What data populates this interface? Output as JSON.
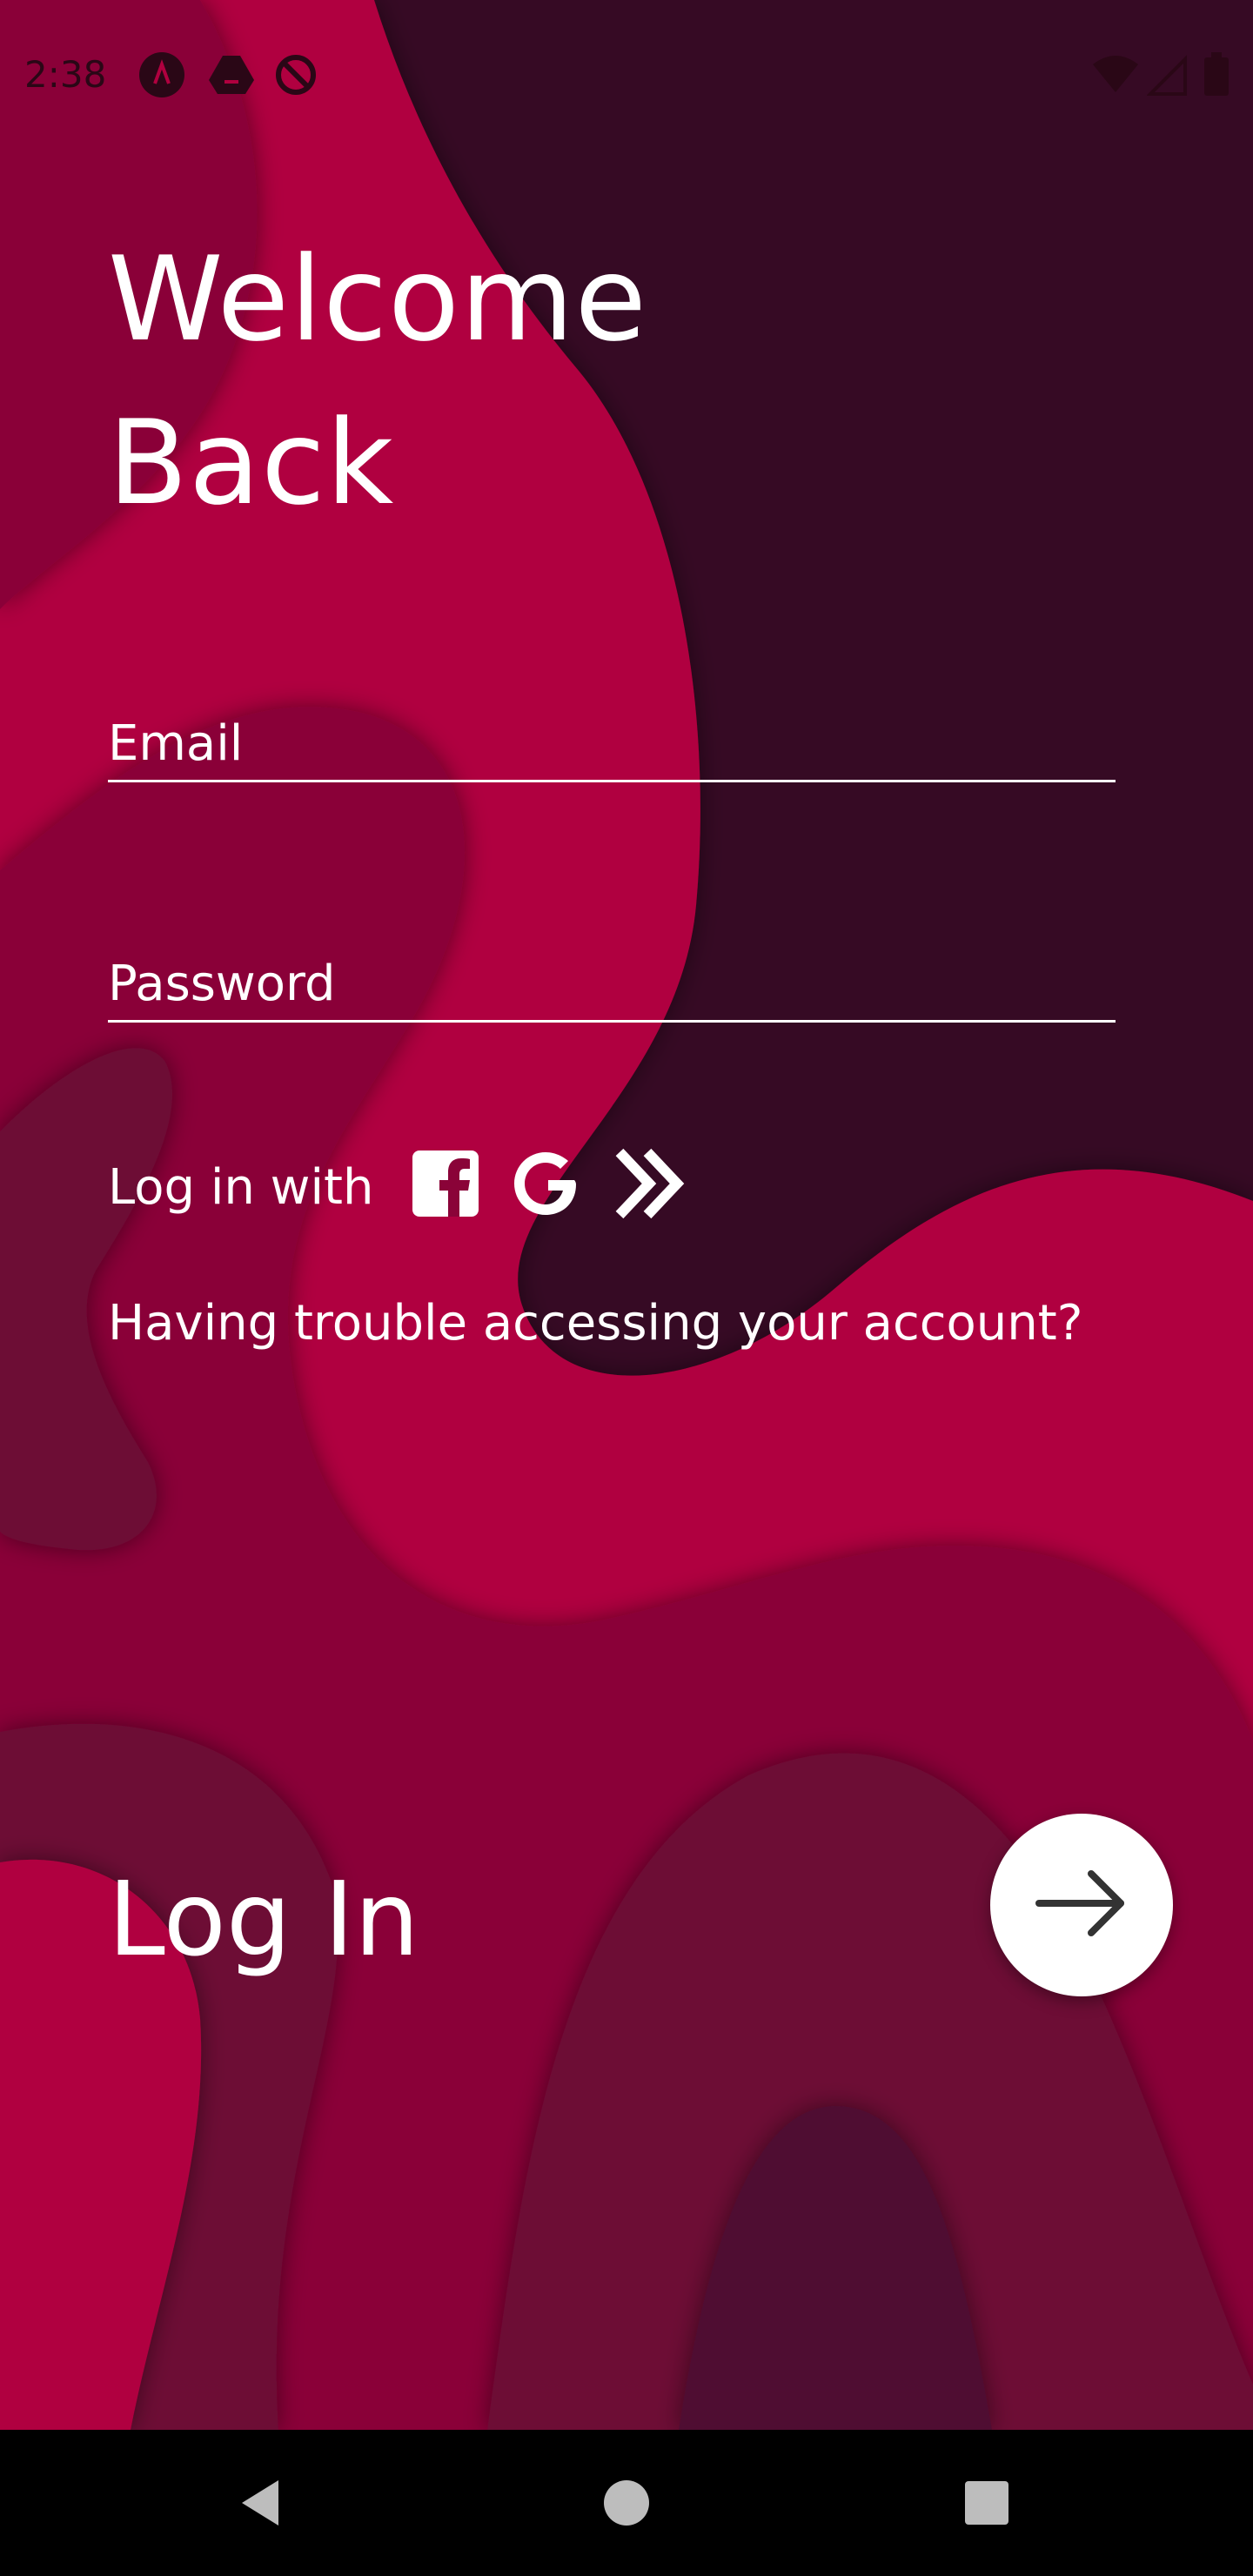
{
  "status_bar": {
    "time": "2:38",
    "notification_icons": [
      "app-icon",
      "drive-icon",
      "sync-off-icon"
    ],
    "system_icons": [
      "wifi-icon",
      "signal-icon",
      "battery-icon"
    ]
  },
  "header": {
    "title": "Welcome\nBack"
  },
  "form": {
    "email_label": "Email",
    "email_value": "",
    "password_label": "Password",
    "password_value": ""
  },
  "social": {
    "label": "Log in with",
    "providers": [
      "facebook-icon",
      "google-icon",
      "double-chevron-icon"
    ]
  },
  "help": {
    "trouble_text": "Having trouble accessing your account?"
  },
  "footer": {
    "login_label": "Log In"
  },
  "nav": {
    "buttons": [
      "back-icon",
      "home-icon",
      "recents-icon"
    ]
  },
  "colors": {
    "dark_plum": "#360a24",
    "crimson": "#b0003f",
    "wine": "#8a0338",
    "maroon": "#6d0a35",
    "deep_wine": "#4f0b30",
    "white": "#ffffff"
  }
}
